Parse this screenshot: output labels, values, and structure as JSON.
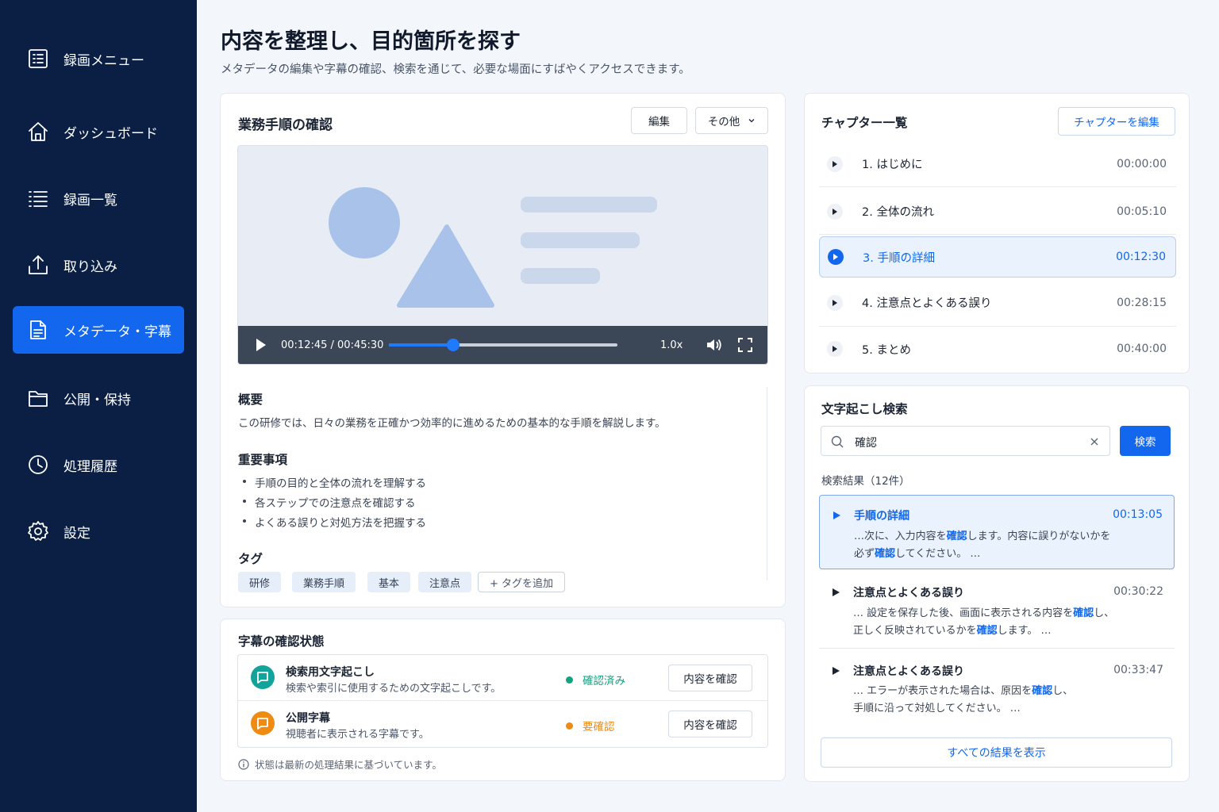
{
  "sidebar": {
    "items": [
      {
        "label": "録画メニュー",
        "icon": "list-box-icon"
      },
      {
        "label": "ダッシュボード",
        "icon": "home-icon"
      },
      {
        "label": "録画一覧",
        "icon": "list-icon"
      },
      {
        "label": "取り込み",
        "icon": "upload-icon"
      },
      {
        "label": "メタデータ・字幕",
        "icon": "document-icon",
        "active": true
      },
      {
        "label": "公開・保持",
        "icon": "folder-icon"
      },
      {
        "label": "処理履歴",
        "icon": "clock-icon"
      },
      {
        "label": "設定",
        "icon": "gear-icon"
      }
    ]
  },
  "header": {
    "title": "内容を整理し、目的箇所を探す",
    "subtitle": "メタデータの編集や字幕の確認、検索を通じて、必要な場面にすばやくアクセスできます。"
  },
  "video_card": {
    "title": "業務手順の確認",
    "edit_label": "編集",
    "more_label": "その他",
    "player": {
      "time": "00:12:45 / 00:45:30",
      "progress": 0.28,
      "speed": "1.0x"
    },
    "summary_label": "概要",
    "summary_text": "この研修では、日々の業務を正確かつ効率的に進めるための基本的な手順を解説します。",
    "key_points_label": "重要事項",
    "key_points": [
      "手順の目的と全体の流れを理解する",
      "各ステップでの注意点を確認する",
      "よくある誤りと対処方法を把握する"
    ],
    "tags_label": "タグ",
    "tags": [
      "研修",
      "業務手順",
      "基本",
      "注意点"
    ],
    "add_tag_label": "+ タグを追加"
  },
  "subtitle_status": {
    "title": "字幕の確認状態",
    "rows": [
      {
        "name": "検索用文字起こし",
        "desc": "検索や索引に使用するための文字起こしです。",
        "status": "確認済み",
        "status_color": "#12a37f",
        "icon_color": "#12a39a",
        "action": "内容を確認"
      },
      {
        "name": "公開字幕",
        "desc": "視聴者に表示される字幕です。",
        "status": "要確認",
        "status_color": "#ef8a12",
        "icon_color": "#ef8a12",
        "action": "内容を確認"
      }
    ],
    "note": "状態は最新の処理結果に基づいています。"
  },
  "chapters": {
    "title": "チャプター一覧",
    "edit_label": "チャプターを編集",
    "items": [
      {
        "label": "1. はじめに",
        "time": "00:00:00"
      },
      {
        "label": "2. 全体の流れ",
        "time": "00:05:10"
      },
      {
        "label": "3. 手順の詳細",
        "time": "00:12:30",
        "active": true
      },
      {
        "label": "4. 注意点とよくある誤り",
        "time": "00:28:15"
      },
      {
        "label": "5. まとめ",
        "time": "00:40:00"
      }
    ]
  },
  "search": {
    "title": "文字起こし検索",
    "query": "確認",
    "button_label": "検索",
    "results_count": "検索結果（12件）",
    "results": [
      {
        "title": "手順の詳細",
        "time": "00:13:05",
        "line1": [
          "…次に、入力内容を",
          "確認",
          "します。内容に誤りがないかを"
        ],
        "line2": [
          "必ず",
          "確認",
          "してください。 …"
        ],
        "active": true
      },
      {
        "title": "注意点とよくある誤り",
        "time": "00:30:22",
        "line1": [
          "… 設定を保存した後、画面に表示される内容を",
          "確認",
          "し、"
        ],
        "line2": [
          "正しく反映されているかを",
          "確認",
          "します。 …"
        ]
      },
      {
        "title": "注意点とよくある誤り",
        "time": "00:33:47",
        "line1": [
          "… エラーが表示された場合は、原因を",
          "確認",
          "し、"
        ],
        "line2": [
          "手順に沿って対処してください。 …",
          "",
          ""
        ]
      }
    ],
    "show_all_label": "すべての結果を表示"
  },
  "colors": {
    "sidebar_bg": "#0b1f45",
    "accent": "#1267ee"
  }
}
